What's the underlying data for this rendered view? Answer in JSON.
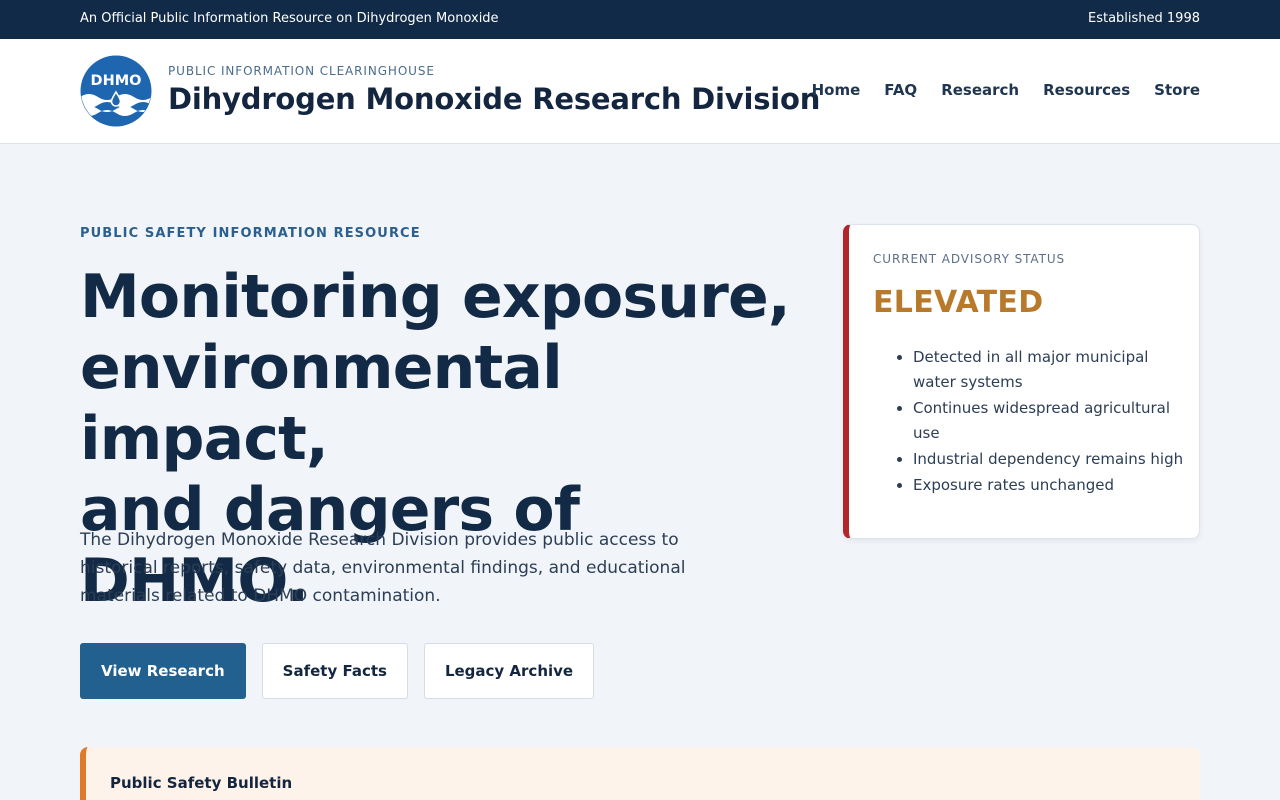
{
  "topbar": {
    "left_text": "An Official Public Information Resource on Dihydrogen Monoxide",
    "right_text": "Established 1998"
  },
  "header": {
    "logo_text": "DHMO",
    "tagline": "PUBLIC INFORMATION CLEARINGHOUSE",
    "org_name": "Dihydrogen Monoxide Research Division",
    "nav": [
      "Home",
      "FAQ",
      "Research",
      "Resources",
      "Store"
    ]
  },
  "hero": {
    "eyebrow": "PUBLIC SAFETY INFORMATION RESOURCE",
    "title_lines": [
      "Monitoring exposure,",
      "environmental impact,",
      "and dangers of DHMO."
    ],
    "description": "The Dihydrogen Monoxide Research Division provides public access to historical reports, safety data, environmental findings, and educational materials related to DHMO contamination.",
    "buttons": {
      "primary": "View Research",
      "secondary": "Safety Facts",
      "tertiary": "Legacy Archive"
    }
  },
  "advisory": {
    "label": "CURRENT ADVISORY STATUS",
    "status": "ELEVATED",
    "items": [
      "Detected in all major municipal water systems",
      "Continues widespread agricultural use",
      "Industrial dependency remains high",
      "Exposure rates unchanged"
    ]
  },
  "bulletin": {
    "title": "Public Safety Bulletin"
  },
  "colors": {
    "navy": "#112a47",
    "accent_blue": "#21608f",
    "alert_red": "#b0262b",
    "status_amber": "#b8792a",
    "bulletin_orange": "#e07a2a"
  },
  "icons": {
    "logo": "water-drop-wave-logo-icon"
  }
}
